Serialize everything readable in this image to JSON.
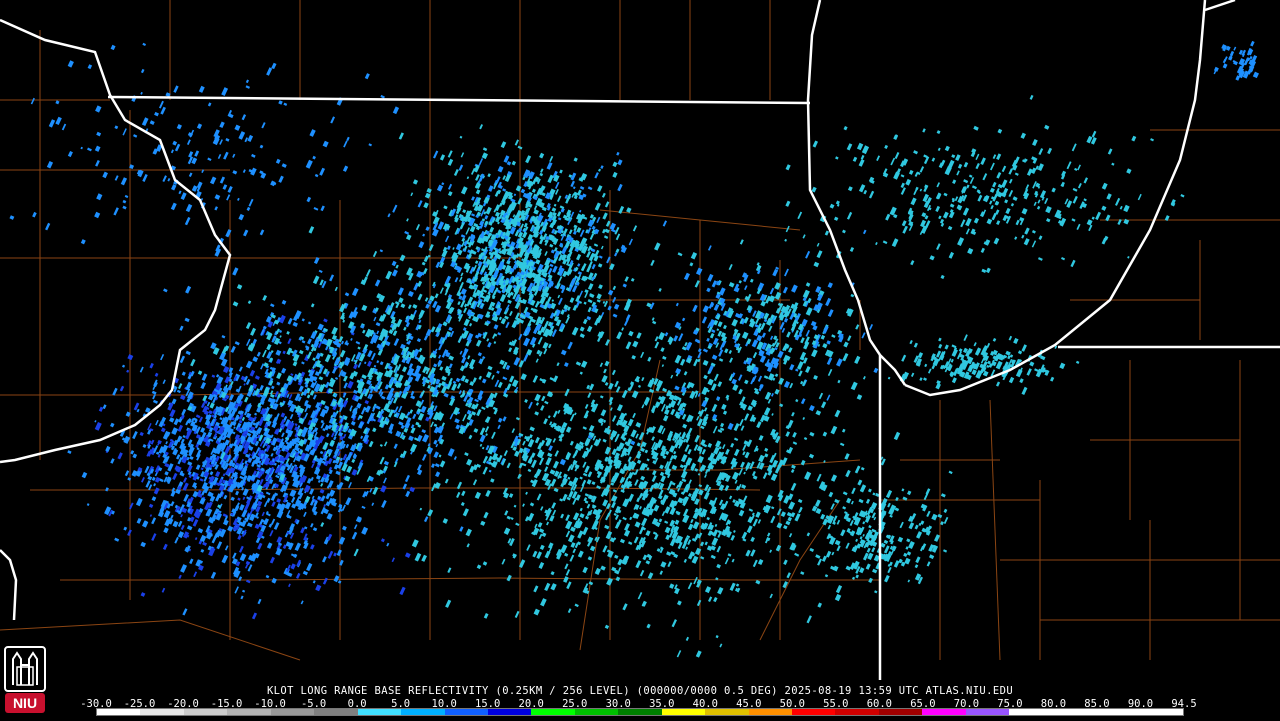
{
  "caption": "KLOT LONG RANGE BASE REFLECTIVITY (0.25KM / 256 LEVEL) (000000/0000 0.5 DEG) 2025-08-19 13:59 UTC  ATLAS.NIU.EDU",
  "logo": {
    "text": "NIU",
    "icon": "niu-logo-icon",
    "color": "#c8102e"
  },
  "scale": {
    "ticks": [
      "-30.0",
      "-25.0",
      "-20.0",
      "-15.0",
      "-10.0",
      "-5.0",
      "0.0",
      "5.0",
      "10.0",
      "15.0",
      "20.0",
      "25.0",
      "30.0",
      "35.0",
      "40.0",
      "45.0",
      "50.0",
      "55.0",
      "60.0",
      "65.0",
      "70.0",
      "75.0",
      "80.0",
      "85.0",
      "90.0",
      "94.5"
    ],
    "colors": [
      "#ffffff",
      "#e6e6e6",
      "#cccccc",
      "#b3b3b3",
      "#999999",
      "#808080",
      "#40e0ff",
      "#00b0ff",
      "#1060ff",
      "#0000e0",
      "#00ff00",
      "#00c000",
      "#008000",
      "#ffff00",
      "#e0c000",
      "#ff9000",
      "#ff0000",
      "#d00000",
      "#a00000",
      "#ff00ff",
      "#9955ff",
      "#ffffff",
      "#ffffff",
      "#ffffff",
      "#ffffff"
    ]
  },
  "map_colors": {
    "state_border": "#ffffff",
    "county_border": "#8b4513",
    "echo_light": "#30c8e0",
    "echo_mid": "#1e90ff",
    "echo_dark": "#1a40e8"
  }
}
